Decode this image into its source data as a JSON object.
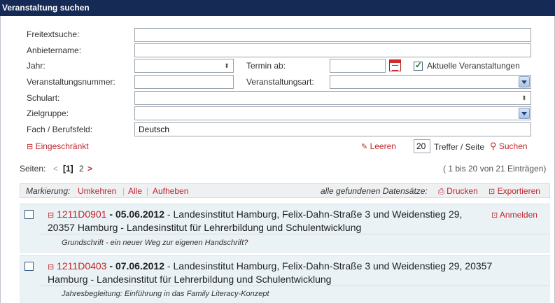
{
  "title": "Veranstaltung suchen",
  "form": {
    "freitext_label": "Freitextsuche:",
    "freitext_value": "",
    "anbieter_label": "Anbietername:",
    "anbieter_value": "",
    "jahr_label": "Jahr:",
    "jahr_value": "",
    "termin_label": "Termin ab:",
    "termin_value": "",
    "aktuelle_label": "Aktuelle Veranstaltungen",
    "aktuelle_checked": true,
    "vnr_label": "Veranstaltungsnummer:",
    "vnr_value": "",
    "vart_label": "Veranstaltungsart:",
    "vart_value": "",
    "schulart_label": "Schulart:",
    "schulart_value": "",
    "zielgruppe_label": "Zielgruppe:",
    "zielgruppe_value": "",
    "fach_label": "Fach / Berufsfeld:",
    "fach_value": "Deutsch"
  },
  "actions": {
    "eingeschraenkt": "Eingeschränkt",
    "leeren": "Leeren",
    "treffer_value": "20",
    "treffer_label": "Treffer / Seite",
    "suchen": "Suchen"
  },
  "pagination": {
    "label": "Seiten:",
    "prev": "<",
    "current": "[1]",
    "page2": "2",
    "next": ">",
    "info": "( 1 bis 20 von 21 Einträgen)"
  },
  "toolbar": {
    "markierung": "Markierung:",
    "umkehren": "Umkehren",
    "alle": "Alle",
    "aufheben": "Aufheben",
    "alle_gefundenen": "alle gefundenen Datensätze:",
    "drucken": "Drucken",
    "exportieren": "Exportieren"
  },
  "results": [
    {
      "number": "1211D0901",
      "date": "05.06.2012",
      "line1": " - Landesinstitut Hamburg, Felix-Dahn-Straße 3 und Weidenstieg 29,",
      "line2": "20357 Hamburg - Landesinstitut für Lehrerbildung und Schulentwicklung",
      "subtitle": "Grundschrift - ein neuer Weg zur eigenen Handschrift?",
      "anmelden": "Anmelden"
    },
    {
      "number": "1211D0403",
      "date": "07.06.2012",
      "line1": " - Landesinstitut Hamburg, Felix-Dahn-Straße 3 und Weidenstieg 29, 20357",
      "line2": "Hamburg - Landesinstitut für Lehrerbildung und Schulentwicklung",
      "subtitle": "Jahresbegleitung: Einführung in das Family Literacy-Konzept"
    }
  ],
  "colors": {
    "titlebar": "#162a56",
    "accent": "#c0262c",
    "result_bg": "#eaf2f5"
  }
}
